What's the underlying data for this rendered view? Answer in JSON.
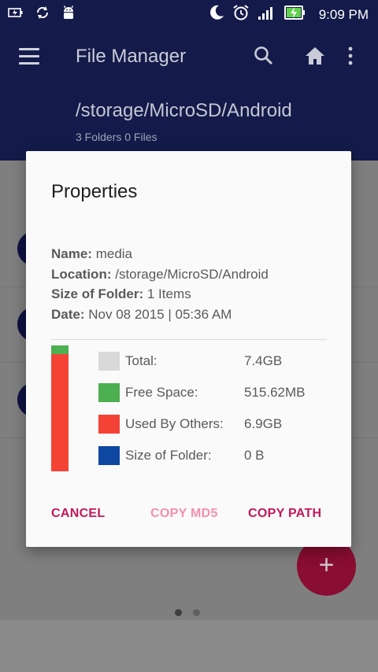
{
  "status_bar": {
    "time": "9:09 PM",
    "icons": [
      "battery-saver-icon",
      "sync-icon",
      "android-debug-icon",
      "moon-icon",
      "alarm-icon",
      "signal-icon",
      "battery-charging-icon"
    ]
  },
  "app_bar": {
    "title": "File Manager",
    "path": "/storage/MicroSD/Android",
    "counts": "3 Folders 0 Files",
    "icons": [
      "menu-icon",
      "search-icon",
      "home-icon",
      "more-vert-icon"
    ]
  },
  "dialog": {
    "title": "Properties",
    "info": [
      {
        "label": "Name:",
        "value": "media"
      },
      {
        "label": "Location:",
        "value": "/storage/MicroSD/Android"
      },
      {
        "label": "Size of Folder:",
        "value": "1 Items"
      },
      {
        "label": "Date:",
        "value": "Nov 08 2015 | 05:36 AM"
      }
    ],
    "storage_bar": {
      "free_fraction": 0.0681,
      "used_fraction": 0.9319
    },
    "legend": [
      {
        "label": "Total:",
        "value": "7.4GB",
        "color": "#d9d9d9"
      },
      {
        "label": "Free Space:",
        "value": "515.62MB",
        "color": "#4caf50"
      },
      {
        "label": "Used By Others:",
        "value": "6.9GB",
        "color": "#f44336"
      },
      {
        "label": "Size of Folder:",
        "value": "0 B",
        "color": "#0d47a1"
      }
    ],
    "buttons": {
      "cancel": "CANCEL",
      "copy_md5": "COPY MD5",
      "copy_path": "COPY PATH"
    }
  },
  "colors": {
    "primary": "#141b4a",
    "accent": "#c2185b",
    "accent_disabled": "#f48fb1",
    "fab": "#8a0d33"
  },
  "fab": {
    "symbol": "+"
  }
}
